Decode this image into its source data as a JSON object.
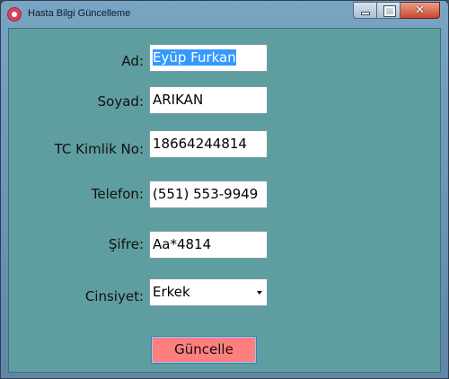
{
  "window": {
    "title": "Hasta Bilgi Güncelleme",
    "close_label": "✕"
  },
  "form": {
    "ad_label": "Ad:",
    "ad_value": "Eyüp Furkan",
    "soyad_label": "Soyad:",
    "soyad_value": "ARIKAN",
    "tc_label": "TC Kimlik No:",
    "tc_value": "18664244814",
    "telefon_label": "Telefon:",
    "telefon_value": "(551) 553-9949",
    "sifre_label": "Şifre:",
    "sifre_value": "Aa*4814",
    "cinsiyet_label": "Cinsiyet:",
    "cinsiyet_value": "Erkek",
    "submit_label": "Güncelle"
  },
  "colors": {
    "client_background": "#5f9ea0",
    "button_background": "#ff7f7f",
    "selection_highlight": "#3399ff"
  }
}
